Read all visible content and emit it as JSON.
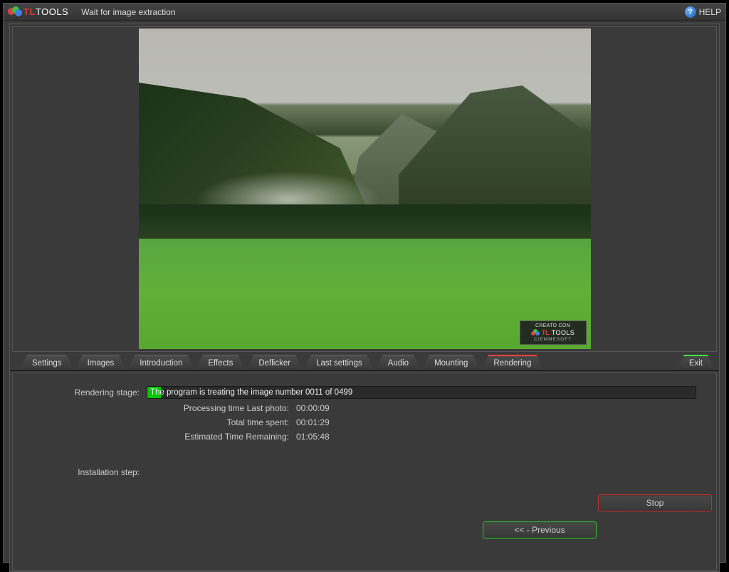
{
  "app": {
    "brand_tl": "TL",
    "brand_tools": "TOOLS",
    "title": "Wait for image extraction",
    "help_label": "HELP"
  },
  "tabs": {
    "settings": "Settings",
    "images": "Images",
    "introduction": "Introduction",
    "effects": "Effects",
    "deflicker": "Deflicker",
    "last_settings": "Last settings",
    "audio": "Audio",
    "mounting": "Mounting",
    "rendering": "Rendering",
    "exit": "Exit"
  },
  "watermark": {
    "top": "CREATO CON",
    "tl": "TL",
    "tools": "TOOLS",
    "bottom": "CIEMMESOFT"
  },
  "render": {
    "stage_label": "Rendering stage:",
    "stage_value": "The program is treating the image number 0011 of 0499",
    "processing_label": "Processing time Last photo:",
    "processing_value": "00:00:09",
    "total_label": "Total time spent:",
    "total_value": "00:01:29",
    "eta_label": "Estimated Time Remaining:",
    "eta_value": "01:05:48",
    "install_label": "Installation step:"
  },
  "buttons": {
    "stop": "Stop",
    "previous": "<< - Previous"
  }
}
